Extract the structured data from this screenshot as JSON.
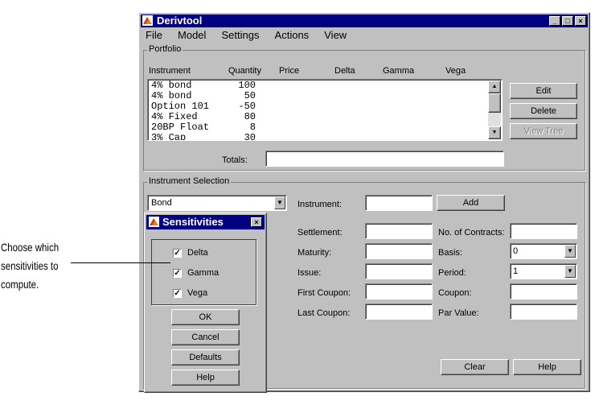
{
  "window": {
    "title": "Derivtool",
    "menu": [
      "File",
      "Model",
      "Settings",
      "Actions",
      "View"
    ]
  },
  "portfolio": {
    "group_title": "Portfolio",
    "columns": [
      "Instrument",
      "Quantity",
      "Price",
      "Delta",
      "Gamma",
      "Vega"
    ],
    "rows": [
      {
        "instrument": "4% bond",
        "quantity": "100"
      },
      {
        "instrument": "4% bond",
        "quantity": "50"
      },
      {
        "instrument": "Option 101",
        "quantity": "-50"
      },
      {
        "instrument": "4% Fixed",
        "quantity": "80"
      },
      {
        "instrument": "20BP Float",
        "quantity": "8"
      },
      {
        "instrument": "3% Cap",
        "quantity": "30"
      }
    ],
    "buttons": {
      "edit": "Edit",
      "delete": "Delete",
      "view_tree": "View Tree"
    },
    "totals_label": "Totals:",
    "totals_value": ""
  },
  "selection": {
    "group_title": "Instrument Selection",
    "type_value": "Bond",
    "instrument_label": "Instrument:",
    "instrument_value": "",
    "add_label": "Add",
    "fields_left": [
      "Settlement:",
      "Maturity:",
      "Issue:",
      "First Coupon:",
      "Last Coupon:"
    ],
    "fields_right": [
      "No. of Contracts:",
      "Basis:",
      "Period:",
      "Coupon:",
      "Par Value:"
    ],
    "basis_value": "0",
    "period_value": "1",
    "clear_label": "Clear",
    "help_label": "Help"
  },
  "sensitivities": {
    "title": "Sensitivities",
    "options": [
      {
        "label": "Delta",
        "checked": true
      },
      {
        "label": "Gamma",
        "checked": true
      },
      {
        "label": "Vega",
        "checked": true
      }
    ],
    "ok": "OK",
    "cancel": "Cancel",
    "defaults": "Defaults",
    "help": "Help"
  },
  "annotation": "Choose which sensitivities to compute."
}
